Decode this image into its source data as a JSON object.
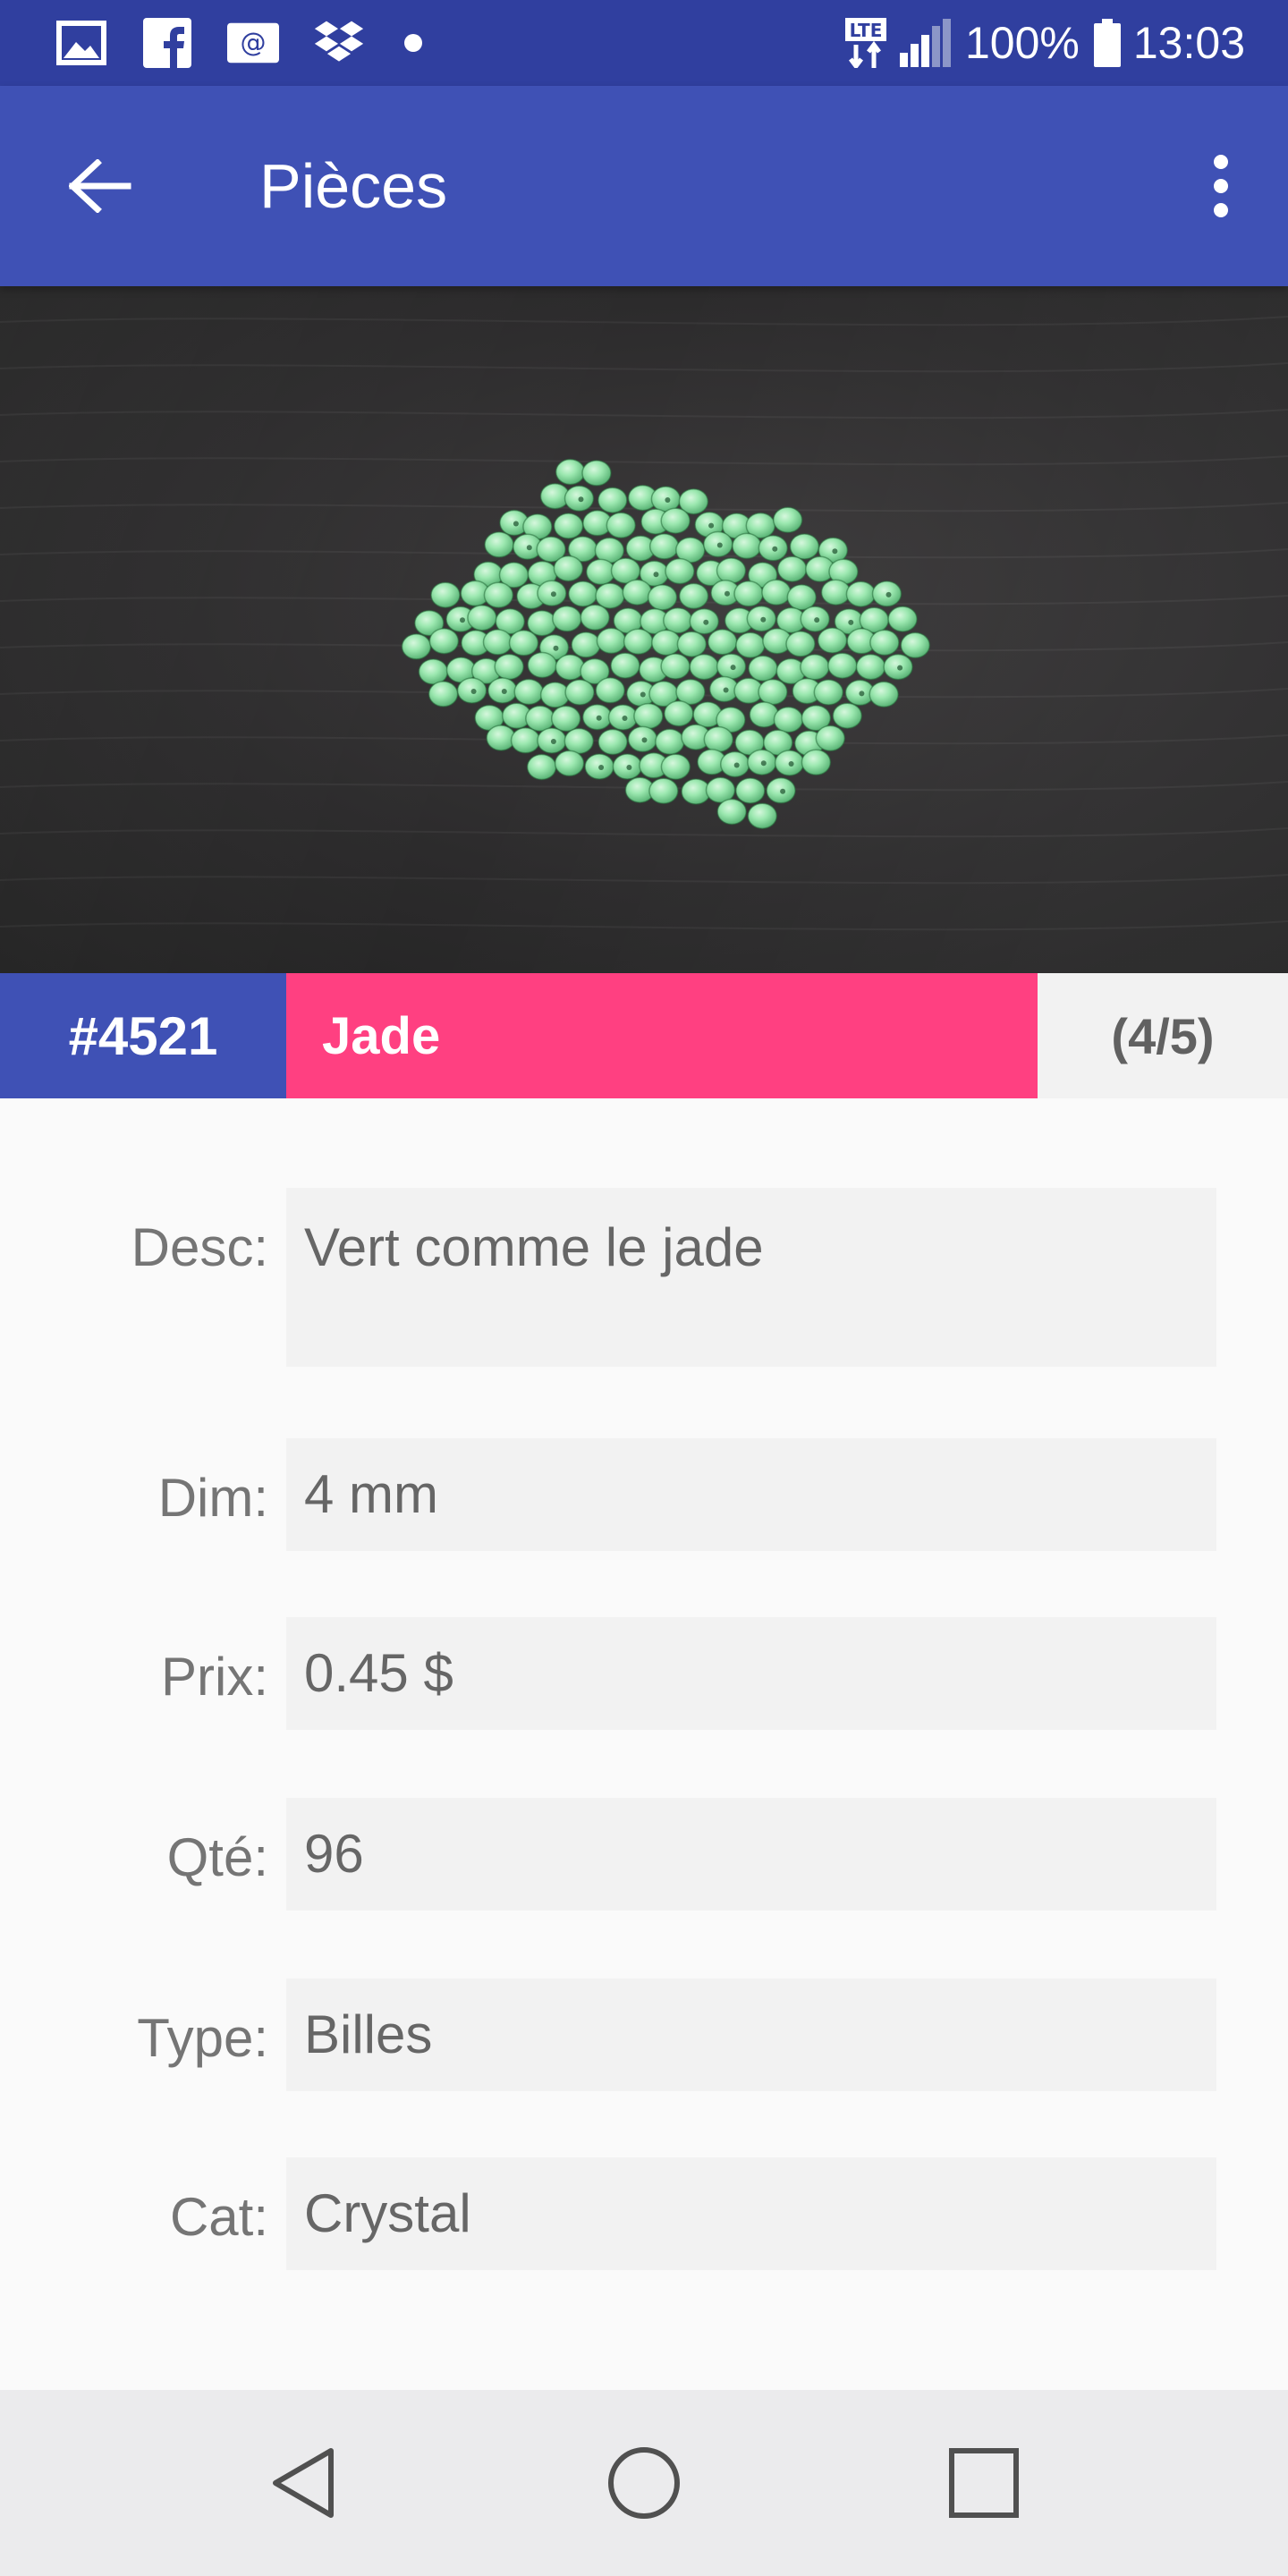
{
  "status_bar": {
    "network": "LTE",
    "battery": "100%",
    "time": "13:03",
    "notification_icons": [
      "gallery-icon",
      "facebook-icon",
      "email-icon",
      "dropbox-icon",
      "dot-icon"
    ]
  },
  "app_bar": {
    "title": "Pièces",
    "back_icon": "arrow-back-icon",
    "menu_icon": "more-vert-icon"
  },
  "item": {
    "id": "#4521",
    "name": "Jade",
    "position": "(4/5)"
  },
  "fields": [
    {
      "label": "Desc:",
      "value": "Vert comme le jade"
    },
    {
      "label": "Dim:",
      "value": "4 mm"
    },
    {
      "label": "Prix:",
      "value": "0.45 $"
    },
    {
      "label": "Qté:",
      "value": "96"
    },
    {
      "label": "Type:",
      "value": "Billes"
    },
    {
      "label": "Cat:",
      "value": "Crystal"
    }
  ],
  "colors": {
    "primary": "#3f51b5",
    "primary_dark": "#303f9f",
    "accent": "#ff4081",
    "bead_green": "#8fe0a4"
  }
}
